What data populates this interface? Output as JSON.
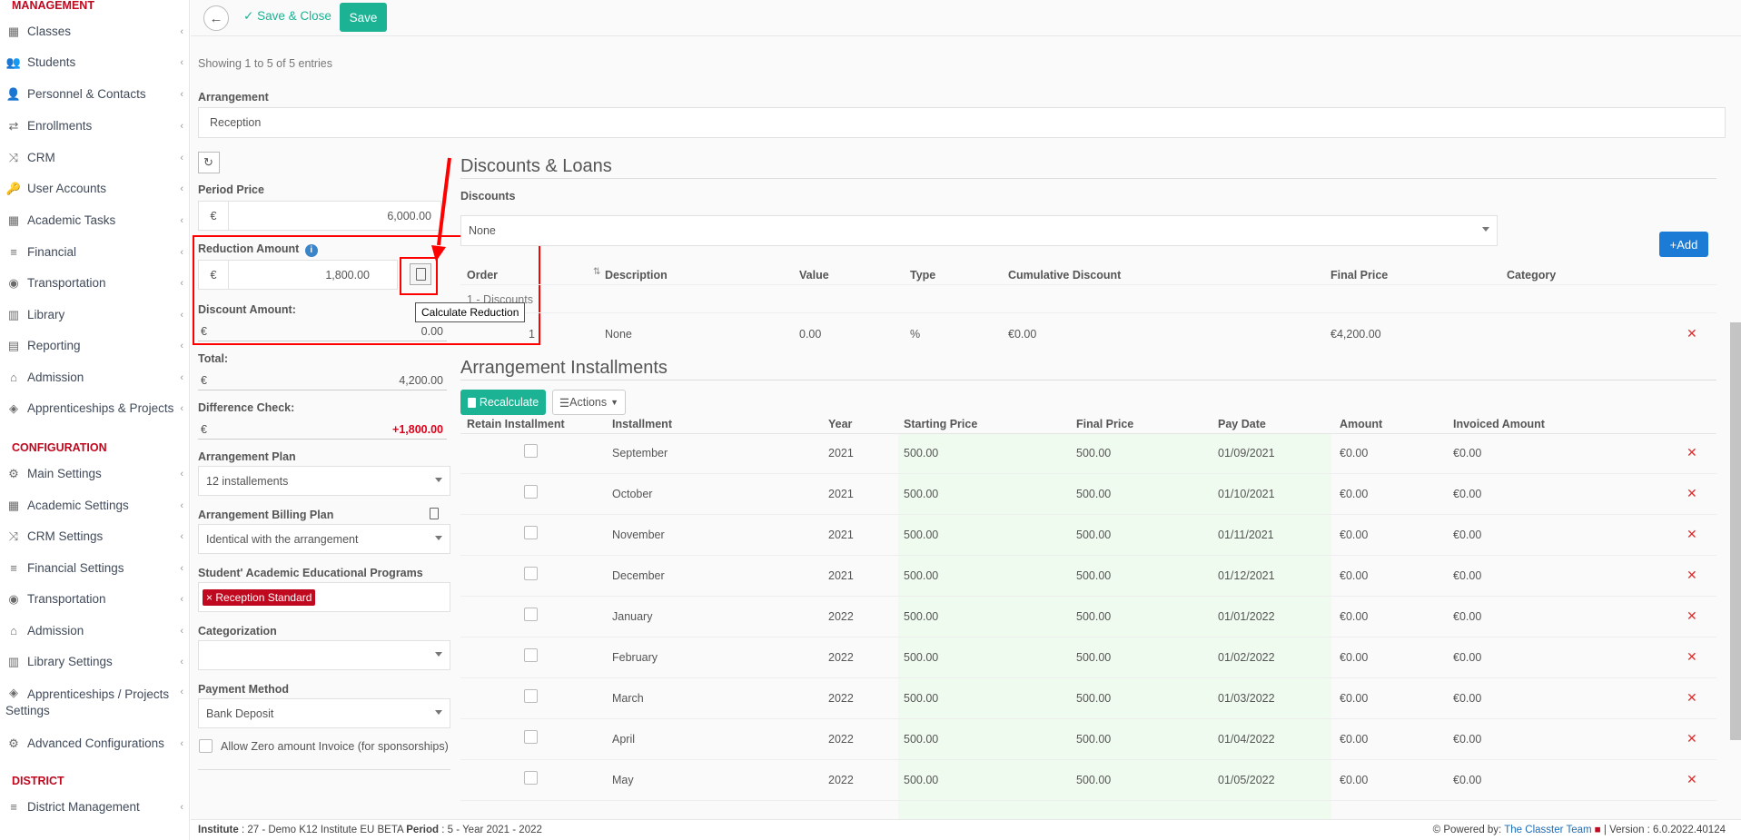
{
  "sidebar": {
    "sec_management": "MANAGEMENT",
    "sec_configuration": "CONFIGURATION",
    "sec_district": "DISTRICT",
    "items": [
      {
        "label": "Classes",
        "icon": "classes-icon"
      },
      {
        "label": "Students",
        "icon": "students-icon"
      },
      {
        "label": "Personnel & Contacts",
        "icon": "personnel-icon"
      },
      {
        "label": "Enrollments",
        "icon": "enrollments-icon"
      },
      {
        "label": "CRM",
        "icon": "crm-icon"
      },
      {
        "label": "User Accounts",
        "icon": "user-accounts-icon"
      },
      {
        "label": "Academic Tasks",
        "icon": "academic-tasks-icon"
      },
      {
        "label": "Financial",
        "icon": "financial-icon"
      },
      {
        "label": "Transportation",
        "icon": "transportation-icon"
      },
      {
        "label": "Library",
        "icon": "library-icon"
      },
      {
        "label": "Reporting",
        "icon": "reporting-icon"
      },
      {
        "label": "Admission",
        "icon": "admission-icon"
      },
      {
        "label": "Apprenticeships & Projects",
        "icon": "apprenticeships-icon"
      }
    ],
    "config_items": [
      {
        "label": "Main Settings",
        "icon": "main-settings-icon"
      },
      {
        "label": "Academic Settings",
        "icon": "academic-settings-icon"
      },
      {
        "label": "CRM Settings",
        "icon": "crm-settings-icon"
      },
      {
        "label": "Financial Settings",
        "icon": "financial-settings-icon"
      },
      {
        "label": "Transportation",
        "icon": "transportation-icon"
      },
      {
        "label": "Admission",
        "icon": "admission-icon"
      },
      {
        "label": "Library Settings",
        "icon": "library-settings-icon"
      },
      {
        "label1": "Apprenticeships / Projects",
        "label2": "Settings",
        "icon": "apprenticeships-settings-icon"
      },
      {
        "label": "Advanced Configurations",
        "icon": "advanced-config-icon"
      }
    ],
    "district_items": [
      {
        "label": "District Management",
        "icon": "district-icon"
      }
    ]
  },
  "topbar": {
    "save_close": "Save & Close",
    "save": "Save"
  },
  "form": {
    "showing": "Showing 1 to 5 of 5 entries",
    "arrangement_label": "Arrangement",
    "arrangement_value": "Reception",
    "period_price_label": "Period Price",
    "currency": "€",
    "period_price": "6,000.00",
    "reduction_label": "Reduction Amount",
    "reduction_value": "1,800.00",
    "tooltip": "Calculate Reduction",
    "discount_amount_label": "Discount Amount:",
    "discount_amount": "0.00",
    "total_label": "Total:",
    "total": "4,200.00",
    "diff_label": "Difference Check:",
    "diff": "+1,800.00",
    "plan_label": "Arrangement Plan",
    "plan_value": "12 installements",
    "billing_label": "Arrangement Billing Plan",
    "billing_value": "Identical with the arrangement",
    "programs_label": "Student' Academic Educational Programs",
    "program_tag": "Reception Standard",
    "categorization_label": "Categorization",
    "payment_label": "Payment Method",
    "payment_value": "Bank Deposit",
    "zero_label": "Allow Zero amount Invoice (for sponsorships)"
  },
  "discounts": {
    "title": "Discounts & Loans",
    "label": "Discounts",
    "select": "None",
    "add": "Add",
    "headers": [
      "Order",
      "Description",
      "Value",
      "Type",
      "Cumulative Discount",
      "Final Price",
      "Category"
    ],
    "group": "1 - Discounts",
    "row": {
      "order": "1",
      "description": "None",
      "value": "0.00",
      "type": "%",
      "cumulative": "€0.00",
      "final": "€4,200.00"
    }
  },
  "installments": {
    "title": "Arrangement Installments",
    "recalculate": "Recalculate",
    "actions": "Actions",
    "headers": [
      "Retain Installment",
      "Installment",
      "Year",
      "Starting Price",
      "Final Price",
      "Pay Date",
      "Amount",
      "Invoiced Amount"
    ],
    "rows": [
      {
        "name": "September",
        "year": "2021",
        "start": "500.00",
        "final": "500.00",
        "date": "01/09/2021",
        "amount": "€0.00",
        "invoiced": "€0.00"
      },
      {
        "name": "October",
        "year": "2021",
        "start": "500.00",
        "final": "500.00",
        "date": "01/10/2021",
        "amount": "€0.00",
        "invoiced": "€0.00"
      },
      {
        "name": "November",
        "year": "2021",
        "start": "500.00",
        "final": "500.00",
        "date": "01/11/2021",
        "amount": "€0.00",
        "invoiced": "€0.00"
      },
      {
        "name": "December",
        "year": "2021",
        "start": "500.00",
        "final": "500.00",
        "date": "01/12/2021",
        "amount": "€0.00",
        "invoiced": "€0.00"
      },
      {
        "name": "January",
        "year": "2022",
        "start": "500.00",
        "final": "500.00",
        "date": "01/01/2022",
        "amount": "€0.00",
        "invoiced": "€0.00"
      },
      {
        "name": "February",
        "year": "2022",
        "start": "500.00",
        "final": "500.00",
        "date": "01/02/2022",
        "amount": "€0.00",
        "invoiced": "€0.00"
      },
      {
        "name": "March",
        "year": "2022",
        "start": "500.00",
        "final": "500.00",
        "date": "01/03/2022",
        "amount": "€0.00",
        "invoiced": "€0.00"
      },
      {
        "name": "April",
        "year": "2022",
        "start": "500.00",
        "final": "500.00",
        "date": "01/04/2022",
        "amount": "€0.00",
        "invoiced": "€0.00"
      },
      {
        "name": "May",
        "year": "2022",
        "start": "500.00",
        "final": "500.00",
        "date": "01/05/2022",
        "amount": "€0.00",
        "invoiced": "€0.00"
      }
    ]
  },
  "footer": {
    "institute_label": "Institute",
    "institute_value": ": 27 - Demo K12 Institute EU BETA",
    "period_label": "Period",
    "period_value": ": 5 - Year 2021 - 2022",
    "powered": "Powered by:",
    "team": "The Classter Team",
    "version": "| Version : 6.0.2022.40124"
  }
}
